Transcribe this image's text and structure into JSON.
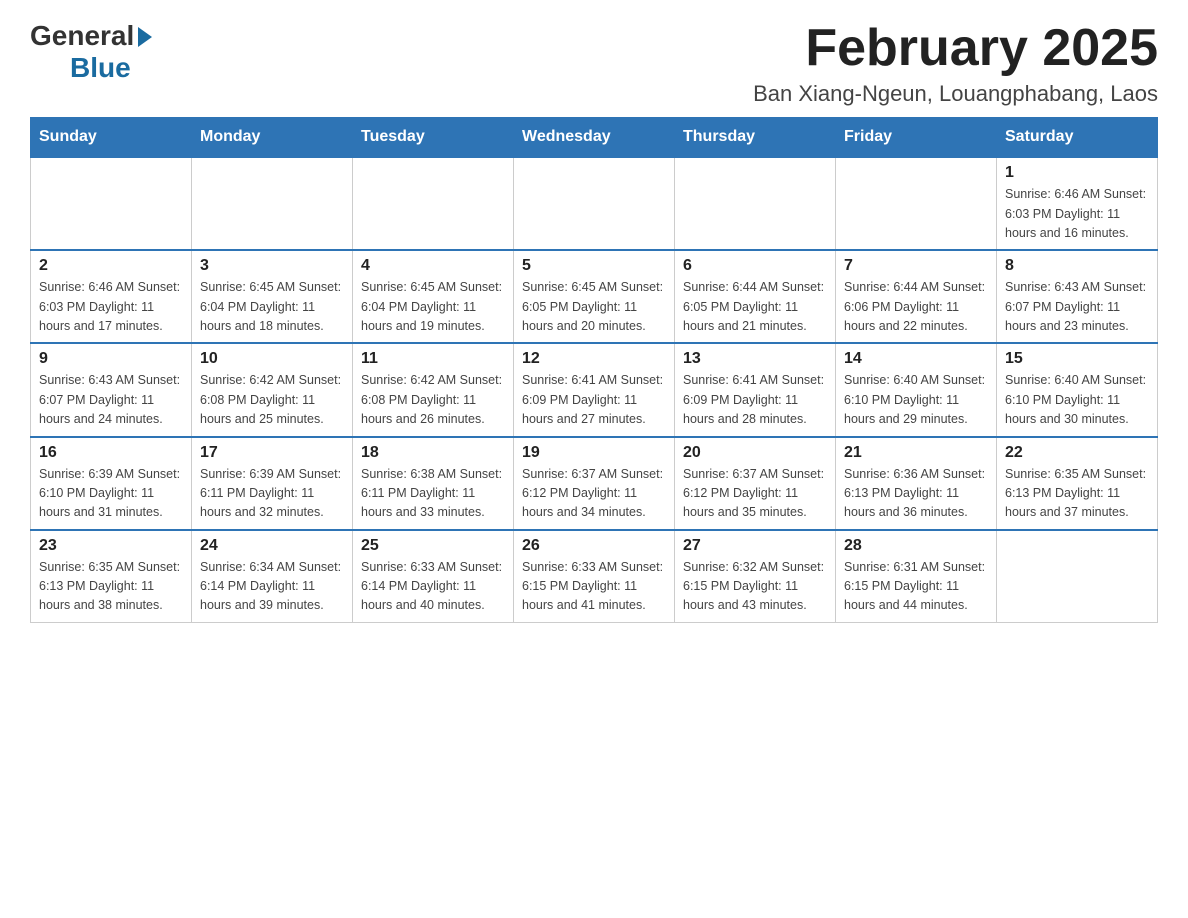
{
  "logo": {
    "general": "General",
    "blue": "Blue"
  },
  "title": "February 2025",
  "location": "Ban Xiang-Ngeun, Louangphabang, Laos",
  "days_of_week": [
    "Sunday",
    "Monday",
    "Tuesday",
    "Wednesday",
    "Thursday",
    "Friday",
    "Saturday"
  ],
  "weeks": [
    [
      {
        "day": "",
        "info": ""
      },
      {
        "day": "",
        "info": ""
      },
      {
        "day": "",
        "info": ""
      },
      {
        "day": "",
        "info": ""
      },
      {
        "day": "",
        "info": ""
      },
      {
        "day": "",
        "info": ""
      },
      {
        "day": "1",
        "info": "Sunrise: 6:46 AM\nSunset: 6:03 PM\nDaylight: 11 hours and 16 minutes."
      }
    ],
    [
      {
        "day": "2",
        "info": "Sunrise: 6:46 AM\nSunset: 6:03 PM\nDaylight: 11 hours and 17 minutes."
      },
      {
        "day": "3",
        "info": "Sunrise: 6:45 AM\nSunset: 6:04 PM\nDaylight: 11 hours and 18 minutes."
      },
      {
        "day": "4",
        "info": "Sunrise: 6:45 AM\nSunset: 6:04 PM\nDaylight: 11 hours and 19 minutes."
      },
      {
        "day": "5",
        "info": "Sunrise: 6:45 AM\nSunset: 6:05 PM\nDaylight: 11 hours and 20 minutes."
      },
      {
        "day": "6",
        "info": "Sunrise: 6:44 AM\nSunset: 6:05 PM\nDaylight: 11 hours and 21 minutes."
      },
      {
        "day": "7",
        "info": "Sunrise: 6:44 AM\nSunset: 6:06 PM\nDaylight: 11 hours and 22 minutes."
      },
      {
        "day": "8",
        "info": "Sunrise: 6:43 AM\nSunset: 6:07 PM\nDaylight: 11 hours and 23 minutes."
      }
    ],
    [
      {
        "day": "9",
        "info": "Sunrise: 6:43 AM\nSunset: 6:07 PM\nDaylight: 11 hours and 24 minutes."
      },
      {
        "day": "10",
        "info": "Sunrise: 6:42 AM\nSunset: 6:08 PM\nDaylight: 11 hours and 25 minutes."
      },
      {
        "day": "11",
        "info": "Sunrise: 6:42 AM\nSunset: 6:08 PM\nDaylight: 11 hours and 26 minutes."
      },
      {
        "day": "12",
        "info": "Sunrise: 6:41 AM\nSunset: 6:09 PM\nDaylight: 11 hours and 27 minutes."
      },
      {
        "day": "13",
        "info": "Sunrise: 6:41 AM\nSunset: 6:09 PM\nDaylight: 11 hours and 28 minutes."
      },
      {
        "day": "14",
        "info": "Sunrise: 6:40 AM\nSunset: 6:10 PM\nDaylight: 11 hours and 29 minutes."
      },
      {
        "day": "15",
        "info": "Sunrise: 6:40 AM\nSunset: 6:10 PM\nDaylight: 11 hours and 30 minutes."
      }
    ],
    [
      {
        "day": "16",
        "info": "Sunrise: 6:39 AM\nSunset: 6:10 PM\nDaylight: 11 hours and 31 minutes."
      },
      {
        "day": "17",
        "info": "Sunrise: 6:39 AM\nSunset: 6:11 PM\nDaylight: 11 hours and 32 minutes."
      },
      {
        "day": "18",
        "info": "Sunrise: 6:38 AM\nSunset: 6:11 PM\nDaylight: 11 hours and 33 minutes."
      },
      {
        "day": "19",
        "info": "Sunrise: 6:37 AM\nSunset: 6:12 PM\nDaylight: 11 hours and 34 minutes."
      },
      {
        "day": "20",
        "info": "Sunrise: 6:37 AM\nSunset: 6:12 PM\nDaylight: 11 hours and 35 minutes."
      },
      {
        "day": "21",
        "info": "Sunrise: 6:36 AM\nSunset: 6:13 PM\nDaylight: 11 hours and 36 minutes."
      },
      {
        "day": "22",
        "info": "Sunrise: 6:35 AM\nSunset: 6:13 PM\nDaylight: 11 hours and 37 minutes."
      }
    ],
    [
      {
        "day": "23",
        "info": "Sunrise: 6:35 AM\nSunset: 6:13 PM\nDaylight: 11 hours and 38 minutes."
      },
      {
        "day": "24",
        "info": "Sunrise: 6:34 AM\nSunset: 6:14 PM\nDaylight: 11 hours and 39 minutes."
      },
      {
        "day": "25",
        "info": "Sunrise: 6:33 AM\nSunset: 6:14 PM\nDaylight: 11 hours and 40 minutes."
      },
      {
        "day": "26",
        "info": "Sunrise: 6:33 AM\nSunset: 6:15 PM\nDaylight: 11 hours and 41 minutes."
      },
      {
        "day": "27",
        "info": "Sunrise: 6:32 AM\nSunset: 6:15 PM\nDaylight: 11 hours and 43 minutes."
      },
      {
        "day": "28",
        "info": "Sunrise: 6:31 AM\nSunset: 6:15 PM\nDaylight: 11 hours and 44 minutes."
      },
      {
        "day": "",
        "info": ""
      }
    ]
  ]
}
